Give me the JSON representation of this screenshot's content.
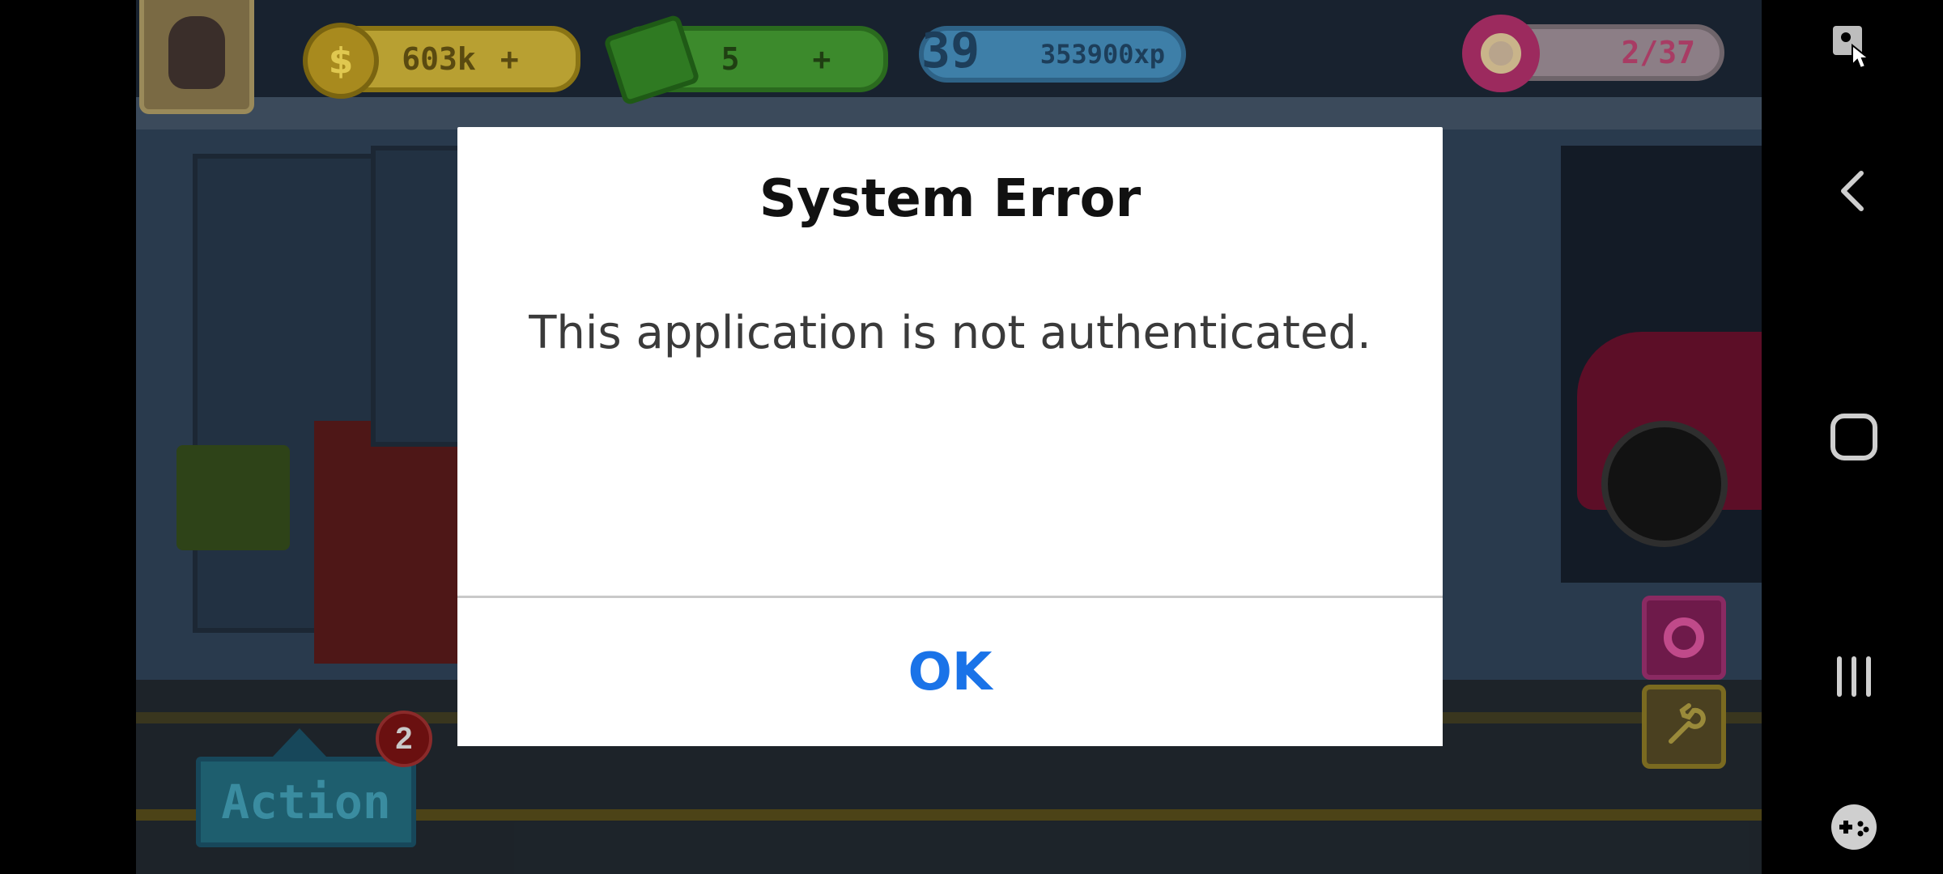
{
  "hud": {
    "coins": "603k",
    "cash": "5",
    "level": "39",
    "xp": "353900xp",
    "donuts": "2/37",
    "plus": "+"
  },
  "game": {
    "action_label": "Action",
    "action_badge": "2"
  },
  "dialog": {
    "title": "System Error",
    "message": "This application is not authenticated.",
    "ok_label": "OK"
  },
  "colors": {
    "ok_text": "#1a73e8",
    "dialog_bg": "#ffffff",
    "title_text": "#111111"
  },
  "navbar": {
    "icons": [
      "screenshot-touch-icon",
      "back-icon",
      "home-icon",
      "recents-icon",
      "game-tools-icon"
    ]
  }
}
